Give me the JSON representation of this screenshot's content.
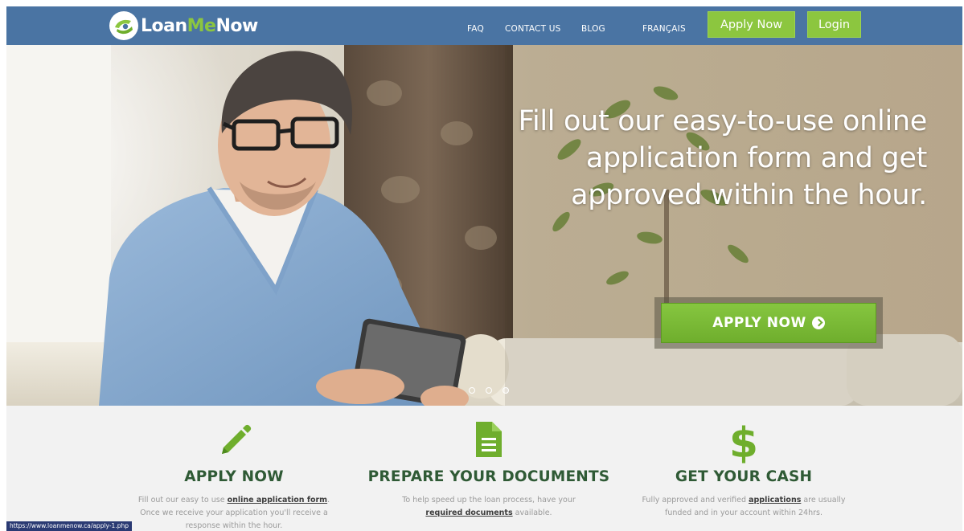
{
  "brand": {
    "logo_part1": "Loan",
    "logo_part2": "Me",
    "logo_part3": "Now",
    "primary_color": "#4a74a3",
    "accent_color": "#8cc63f"
  },
  "nav": {
    "faq": "FAQ",
    "contact": "CONTACT US",
    "blog": "BLOG",
    "language": "FRANÇAIS",
    "apply_button": "Apply Now",
    "login_button": "Login"
  },
  "hero": {
    "heading_line1": "Fill out our easy-to-use online",
    "heading_line2": "application form and get",
    "heading_line3": "approved within the hour.",
    "cta_label": "APPLY NOW",
    "cta_icon": "circle-chevron-right-icon",
    "slider_count": 3,
    "active_slide": 3
  },
  "features": [
    {
      "icon": "pencil-icon",
      "title": "APPLY NOW",
      "text_before": "Fill out our easy to use ",
      "link": "online application form",
      "text_after": ".",
      "text_line2": "Once we receive your application you'll receive a",
      "text_line3": "response within the hour."
    },
    {
      "icon": "document-icon",
      "title": "PREPARE YOUR DOCUMENTS",
      "text_line1": "To help speed up the loan process, have your",
      "link": "required documents",
      "text_after": " available."
    },
    {
      "icon": "dollar-icon",
      "title": "GET YOUR CASH",
      "text_before": "Fully approved and verified ",
      "link": "applications",
      "text_after": " are usually",
      "text_line2": "funded and in your account within 24hrs."
    }
  ],
  "status_bar": {
    "url": "https://www.loanmenow.ca/apply-1.php"
  }
}
